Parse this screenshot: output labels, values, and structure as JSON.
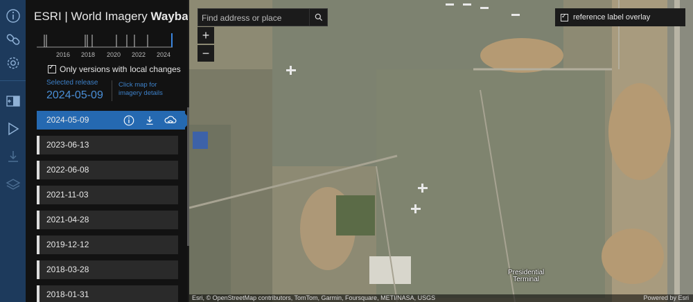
{
  "app": {
    "title_prefix": "ESRI | World Imagery ",
    "title_bold": "Wayback"
  },
  "gutter": {
    "icons": [
      "info-icon",
      "link-icon",
      "gear-icon",
      "swipe-icon",
      "play-icon",
      "download-icon",
      "layers-icon"
    ]
  },
  "timeline": {
    "labels": [
      "2016",
      "2018",
      "2020",
      "2022",
      "2024"
    ]
  },
  "filter": {
    "label_main": "Only versions with",
    "label_bold": "local changes"
  },
  "selected": {
    "label": "Selected release",
    "date": "2024-05-09",
    "hint": "Click map for imagery details"
  },
  "releases": [
    {
      "date": "2024-05-09",
      "active": true
    },
    {
      "date": "2023-06-13"
    },
    {
      "date": "2022-06-08"
    },
    {
      "date": "2021-11-03"
    },
    {
      "date": "2021-04-28"
    },
    {
      "date": "2019-12-12"
    },
    {
      "date": "2018-03-28"
    },
    {
      "date": "2018-01-31"
    }
  ],
  "map": {
    "search_placeholder": "Find address or place",
    "zoom_in": "+",
    "zoom_out": "−",
    "overlay_label": "reference label overlay",
    "place_label_1": "Presidential",
    "place_label_2": "Terminal",
    "attribution": "Esri, © OpenStreetMap contributors, TomTom, Garmin, Foursquare, METI/NASA, USGS",
    "powered": "Powered by Esri"
  }
}
